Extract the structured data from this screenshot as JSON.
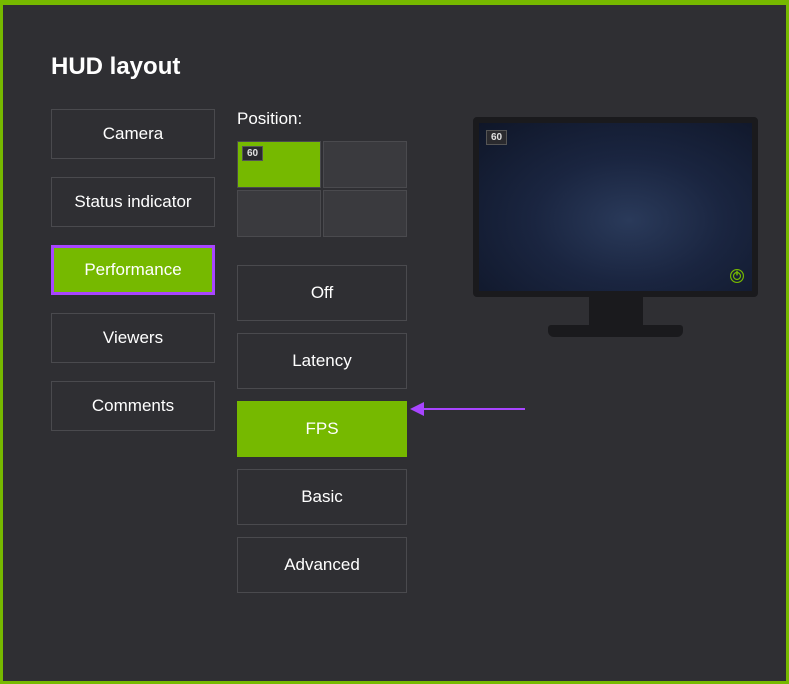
{
  "title": "HUD layout",
  "categories": [
    {
      "label": "Camera",
      "selected": false
    },
    {
      "label": "Status indicator",
      "selected": false
    },
    {
      "label": "Performance",
      "selected": true
    },
    {
      "label": "Viewers",
      "selected": false
    },
    {
      "label": "Comments",
      "selected": false
    }
  ],
  "position": {
    "label": "Position:",
    "selected_index": 0,
    "badge_value": "60"
  },
  "options": [
    {
      "label": "Off",
      "selected": false
    },
    {
      "label": "Latency",
      "selected": false
    },
    {
      "label": "FPS",
      "selected": true
    },
    {
      "label": "Basic",
      "selected": false
    },
    {
      "label": "Advanced",
      "selected": false
    }
  ],
  "preview": {
    "fps_badge": "60"
  },
  "colors": {
    "accent": "#76b900",
    "highlight": "#a845ff",
    "background": "#2f2f33"
  }
}
